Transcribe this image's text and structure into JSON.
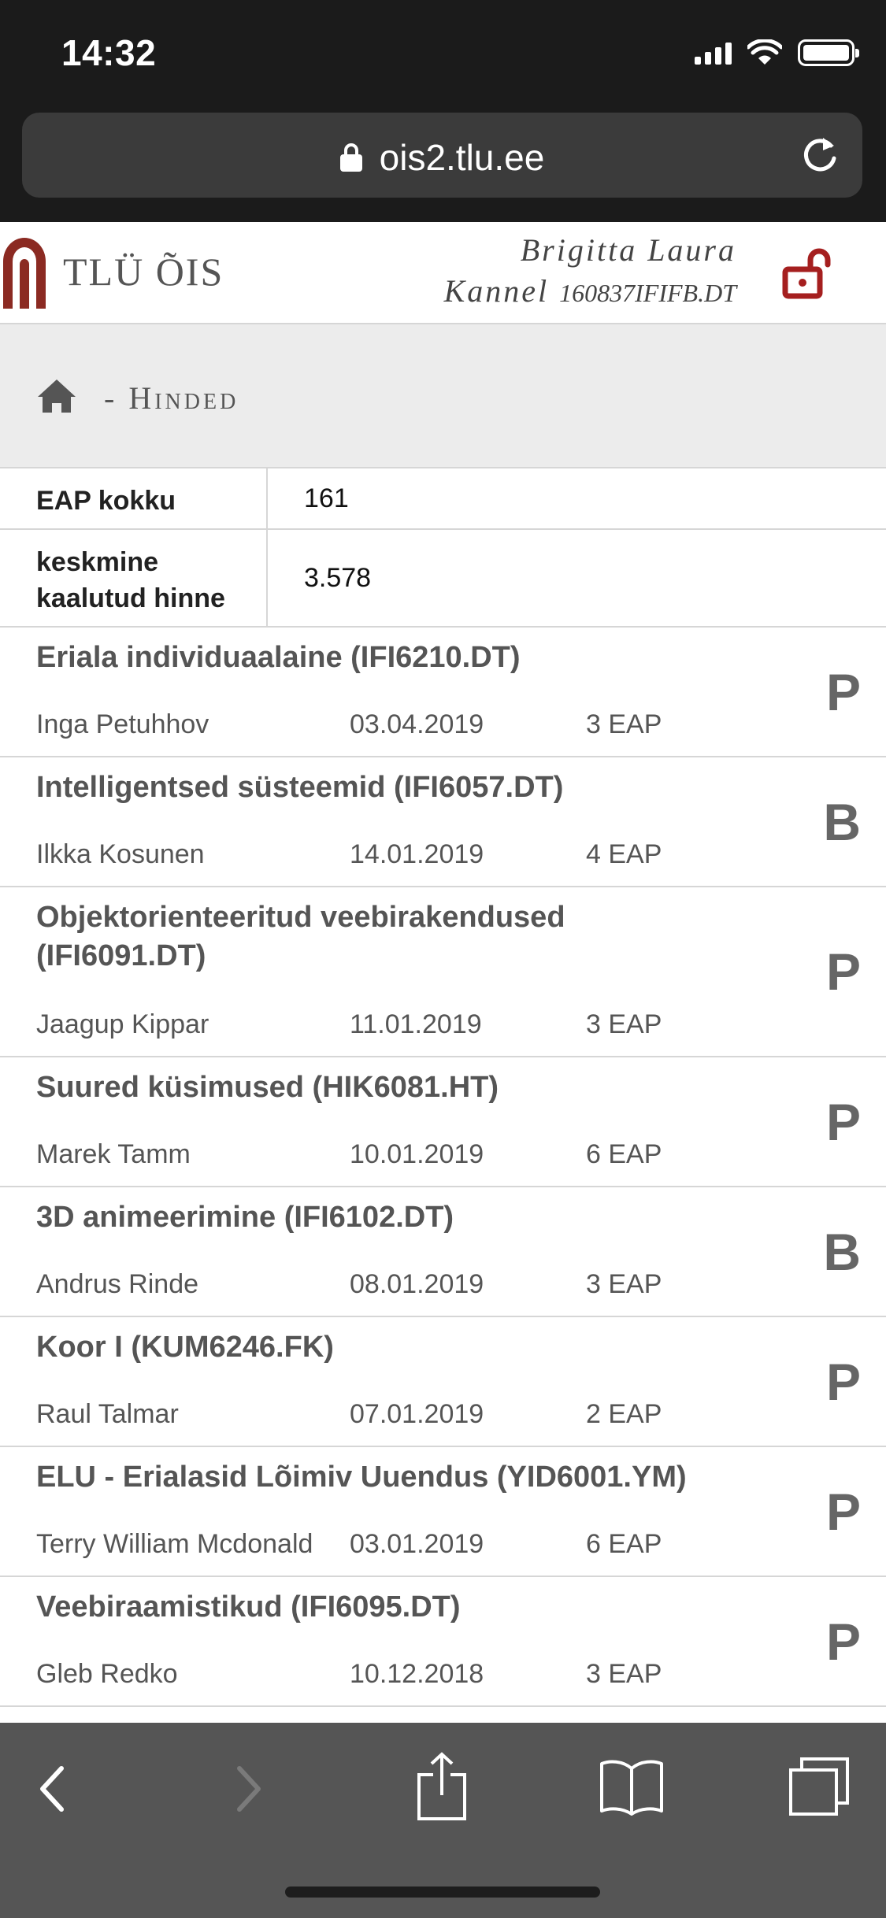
{
  "status_bar": {
    "time": "14:32"
  },
  "browser": {
    "url": "ois2.tlu.ee"
  },
  "header": {
    "logo_text": "TLÜ ÕIS",
    "user_line1": "Brigitta Laura",
    "user_line2": "Kannel",
    "user_id": "160837IFIFB.DT",
    "accent_color": "#a51f1f"
  },
  "breadcrumb": {
    "separator": "-",
    "page": "Hinded"
  },
  "summary": {
    "eap_label": "EAP kokku",
    "eap_value": "161",
    "avg_label": "keskmine kaalutud hinne",
    "avg_value": "3.578"
  },
  "grades": [
    {
      "title": "Eriala individuaalaine (IFI6210.DT)",
      "teacher": "Inga Petuhhov",
      "date": "03.04.2019",
      "eap": "3 EAP",
      "grade": "P"
    },
    {
      "title": "Intelligentsed süsteemid (IFI6057.DT)",
      "teacher": "Ilkka Kosunen",
      "date": "14.01.2019",
      "eap": "4 EAP",
      "grade": "B"
    },
    {
      "title": "Objektorienteeritud veebirakendused (IFI6091.DT)",
      "teacher": "Jaagup Kippar",
      "date": "11.01.2019",
      "eap": "3 EAP",
      "grade": "P"
    },
    {
      "title": "Suured küsimused (HIK6081.HT)",
      "teacher": "Marek Tamm",
      "date": "10.01.2019",
      "eap": "6 EAP",
      "grade": "P"
    },
    {
      "title": "3D animeerimine (IFI6102.DT)",
      "teacher": "Andrus Rinde",
      "date": "08.01.2019",
      "eap": "3 EAP",
      "grade": "B"
    },
    {
      "title": "Koor I (KUM6246.FK)",
      "teacher": "Raul Talmar",
      "date": "07.01.2019",
      "eap": "2 EAP",
      "grade": "P"
    },
    {
      "title": "ELU - Erialasid Lõimiv Uuendus (YID6001.YM)",
      "teacher": "Terry William Mcdonald",
      "date": "03.01.2019",
      "eap": "6 EAP",
      "grade": "P"
    },
    {
      "title": "Veebiraamistikud (IFI6095.DT)",
      "teacher": "Gleb Redko",
      "date": "10.12.2018",
      "eap": "3 EAP",
      "grade": "P"
    }
  ],
  "toolbar_icons": [
    "back-icon",
    "forward-icon",
    "share-icon",
    "bookmarks-icon",
    "tabs-icon"
  ]
}
